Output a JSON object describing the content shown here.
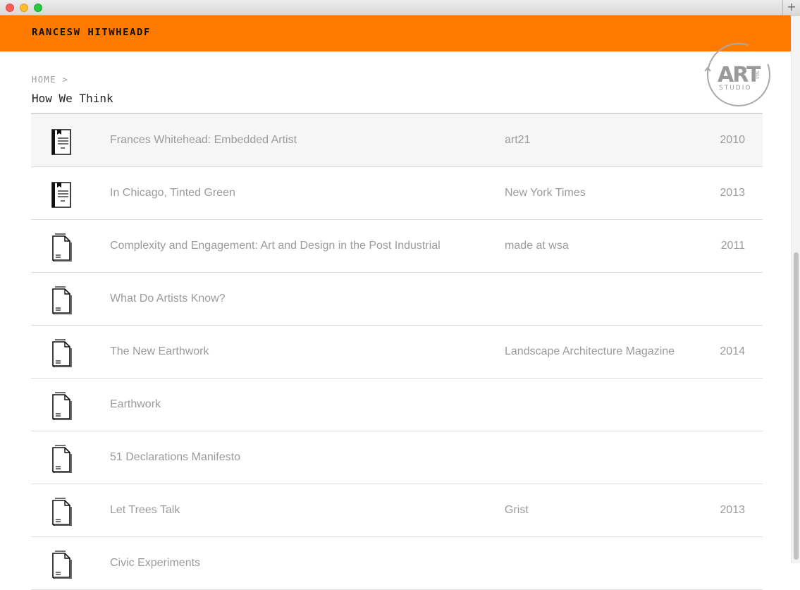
{
  "window": {
    "new_tab_symbol": "+"
  },
  "header": {
    "site_name": "RANCESW HITWHEADF"
  },
  "logo": {
    "text_main": "ART",
    "text_sub": "STUDIO",
    "text_small": "STAL"
  },
  "breadcrumb": {
    "home": "HOME >"
  },
  "page": {
    "title": "How We Think"
  },
  "items": [
    {
      "icon": "book-icon",
      "title": "Frances Whitehead: Embedded Artist",
      "source": "art21",
      "year": "2010"
    },
    {
      "icon": "book-icon",
      "title": "In Chicago, Tinted Green",
      "source": "New York Times",
      "year": "2013"
    },
    {
      "icon": "document-icon",
      "title": "Complexity and Engagement: Art and Design in the Post Industrial",
      "source": "made at wsa",
      "year": "2011"
    },
    {
      "icon": "document-icon",
      "title": "What Do Artists Know?",
      "source": "",
      "year": ""
    },
    {
      "icon": "document-icon",
      "title": "The New Earthwork",
      "source": "Landscape Architecture Magazine",
      "year": "2014"
    },
    {
      "icon": "document-icon",
      "title": "Earthwork",
      "source": "",
      "year": ""
    },
    {
      "icon": "document-icon",
      "title": "51 Declarations Manifesto",
      "source": "",
      "year": ""
    },
    {
      "icon": "document-icon",
      "title": "Let Trees Talk",
      "source": "Grist",
      "year": "2013"
    },
    {
      "icon": "document-icon",
      "title": "Civic Experiments",
      "source": "",
      "year": ""
    }
  ],
  "colors": {
    "header": "#ff7b00",
    "text_muted": "#9b9b9b"
  }
}
